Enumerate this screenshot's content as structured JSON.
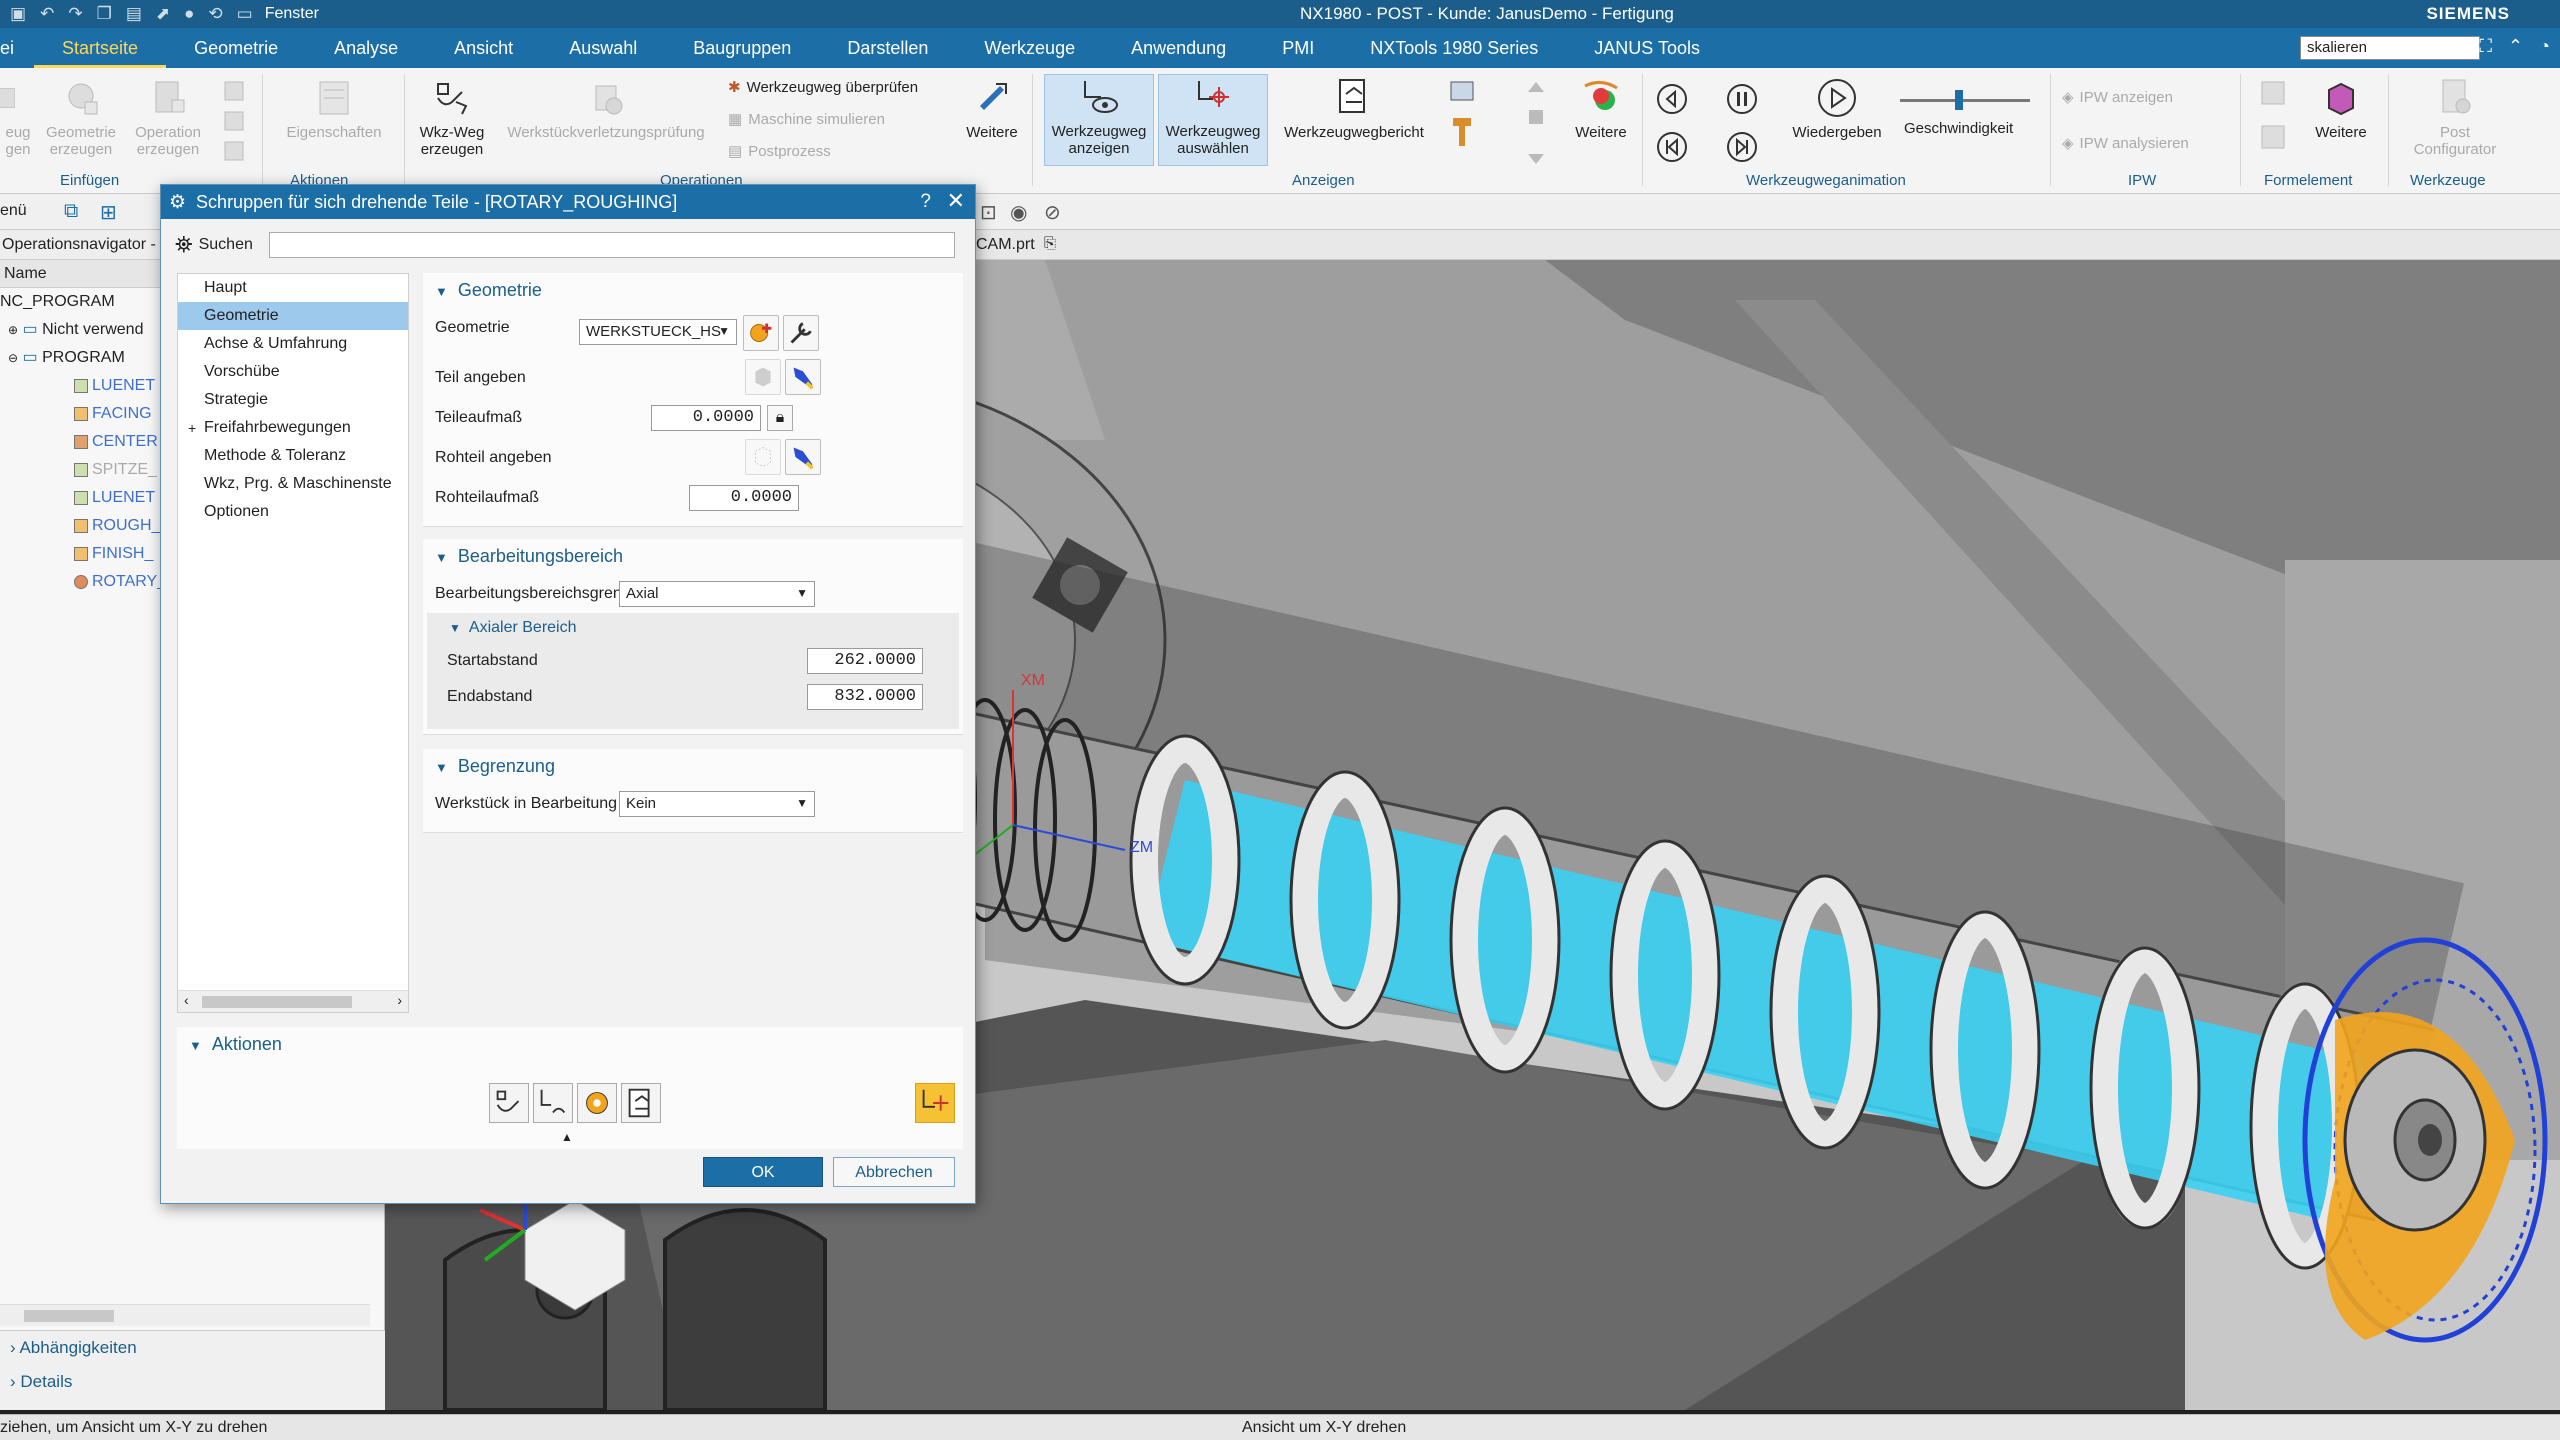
{
  "titlebar": {
    "window_menu": "Fenster",
    "title": "NX1980 - POST - Kunde: JanusDemo - Fertigung",
    "brand": "SIEMENS"
  },
  "menu": {
    "tabs": [
      "ei",
      "Startseite",
      "Geometrie",
      "Analyse",
      "Ansicht",
      "Auswahl",
      "Baugruppen",
      "Darstellen",
      "Werkzeuge",
      "Anwendung",
      "PMI",
      "NXTools 1980 Series",
      "JANUS Tools"
    ],
    "active_index": 1,
    "search_value": "skalieren"
  },
  "ribbon": {
    "einfuegen": {
      "group": "Einfügen",
      "b1": "eug",
      "b1b": "gen",
      "b2": "Geometrie",
      "b2b": "erzeugen",
      "b3": "Operation",
      "b3b": "erzeugen"
    },
    "aktionen": {
      "group": "Aktionen",
      "b1": "Eigenschaften"
    },
    "operationen": {
      "group": "Operationen",
      "b1": "Wkz-Weg",
      "b1b": "erzeugen",
      "b2": "Werkstückverletzungsprüfung",
      "s1": "Werkzeugweg überprüfen",
      "s2": "Maschine simulieren",
      "s3": "Postprozess",
      "more": "Weitere"
    },
    "anzeigen": {
      "group": "Anzeigen",
      "b1": "Werkzeugweg",
      "b1b": "anzeigen",
      "b2": "Werkzeugweg",
      "b2b": "auswählen",
      "b3": "Werkzeugwegbericht",
      "more": "Weitere"
    },
    "animation": {
      "group": "Werkzeugweganimation",
      "play": "Wiedergeben",
      "speed": "Geschwindigkeit",
      "speed_fraction": 0.45
    },
    "ipw": {
      "group": "IPW",
      "s1": "IPW anzeigen",
      "s2": "IPW analysieren"
    },
    "formelemente": {
      "group": "Formelement",
      "more": "Weitere"
    },
    "werkzeuge": {
      "group": "Werkzeuge",
      "b1": "Post",
      "b1b": "Configurator"
    }
  },
  "toolbar2": {
    "menu_stub": "enü"
  },
  "file_tab": {
    "name": "CAM.prt"
  },
  "navigator": {
    "title": "Operationsnavigator -",
    "col_name": "Name",
    "root": "NC_PROGRAM",
    "unused": "Nicht verwend",
    "program": "PROGRAM",
    "ops": [
      "LUENET",
      "FACING",
      "CENTER",
      "SPITZE_",
      "LUENET",
      "ROUGH_",
      "FINISH_",
      "ROTARY_"
    ],
    "bottom": [
      "Abhängigkeiten",
      "Details"
    ]
  },
  "statusbar": {
    "left": "ziehen, um Ansicht um X-Y zu drehen",
    "center": "Ansicht um X-Y drehen"
  },
  "dialog": {
    "title": "Schruppen für sich drehende Teile - [ROTARY_ROUGHING]",
    "help": "?",
    "search_label": "Suchen",
    "tree": [
      "Haupt",
      "Geometrie",
      "Achse & Umfahrung",
      "Vorschübe",
      "Strategie",
      "Freifahrbewegungen",
      "Methode & Toleranz",
      "Wkz, Prg. & Maschinenste",
      "Optionen"
    ],
    "tree_selected": 1,
    "geometrie": {
      "header": "Geometrie",
      "geom_label": "Geometrie",
      "geom_value": "WERKSTUECK_HS",
      "teil_label": "Teil angeben",
      "teilaufmass_label": "Teileaufmaß",
      "teilaufmass_value": "0.0000",
      "rohteil_label": "Rohteil angeben",
      "rohteilaufmass_label": "Rohteilaufmaß",
      "rohteilaufmass_value": "0.0000"
    },
    "bereich": {
      "header": "Bearbeitungsbereich",
      "grenze_label": "Bearbeitungsbereichsgrenze",
      "grenze_value": "Axial",
      "sub_header": "Axialer Bereich",
      "start_label": "Startabstand",
      "start_value": "262.0000",
      "end_label": "Endabstand",
      "end_value": "832.0000"
    },
    "begrenzung": {
      "header": "Begrenzung",
      "werkstueck_label": "Werkstück in Bearbeitung",
      "werkstueck_value": "Kein"
    },
    "aktionen": {
      "header": "Aktionen"
    },
    "ok": "OK",
    "cancel": "Abbrechen"
  },
  "viewport": {
    "axis_xm": "XM",
    "axis_zm": "ZM"
  },
  "colors": {
    "accent": "#1b6ea6",
    "toolpath": "#29c6f0",
    "orange": "#f2a41c",
    "blue_ring": "#2040d8"
  }
}
